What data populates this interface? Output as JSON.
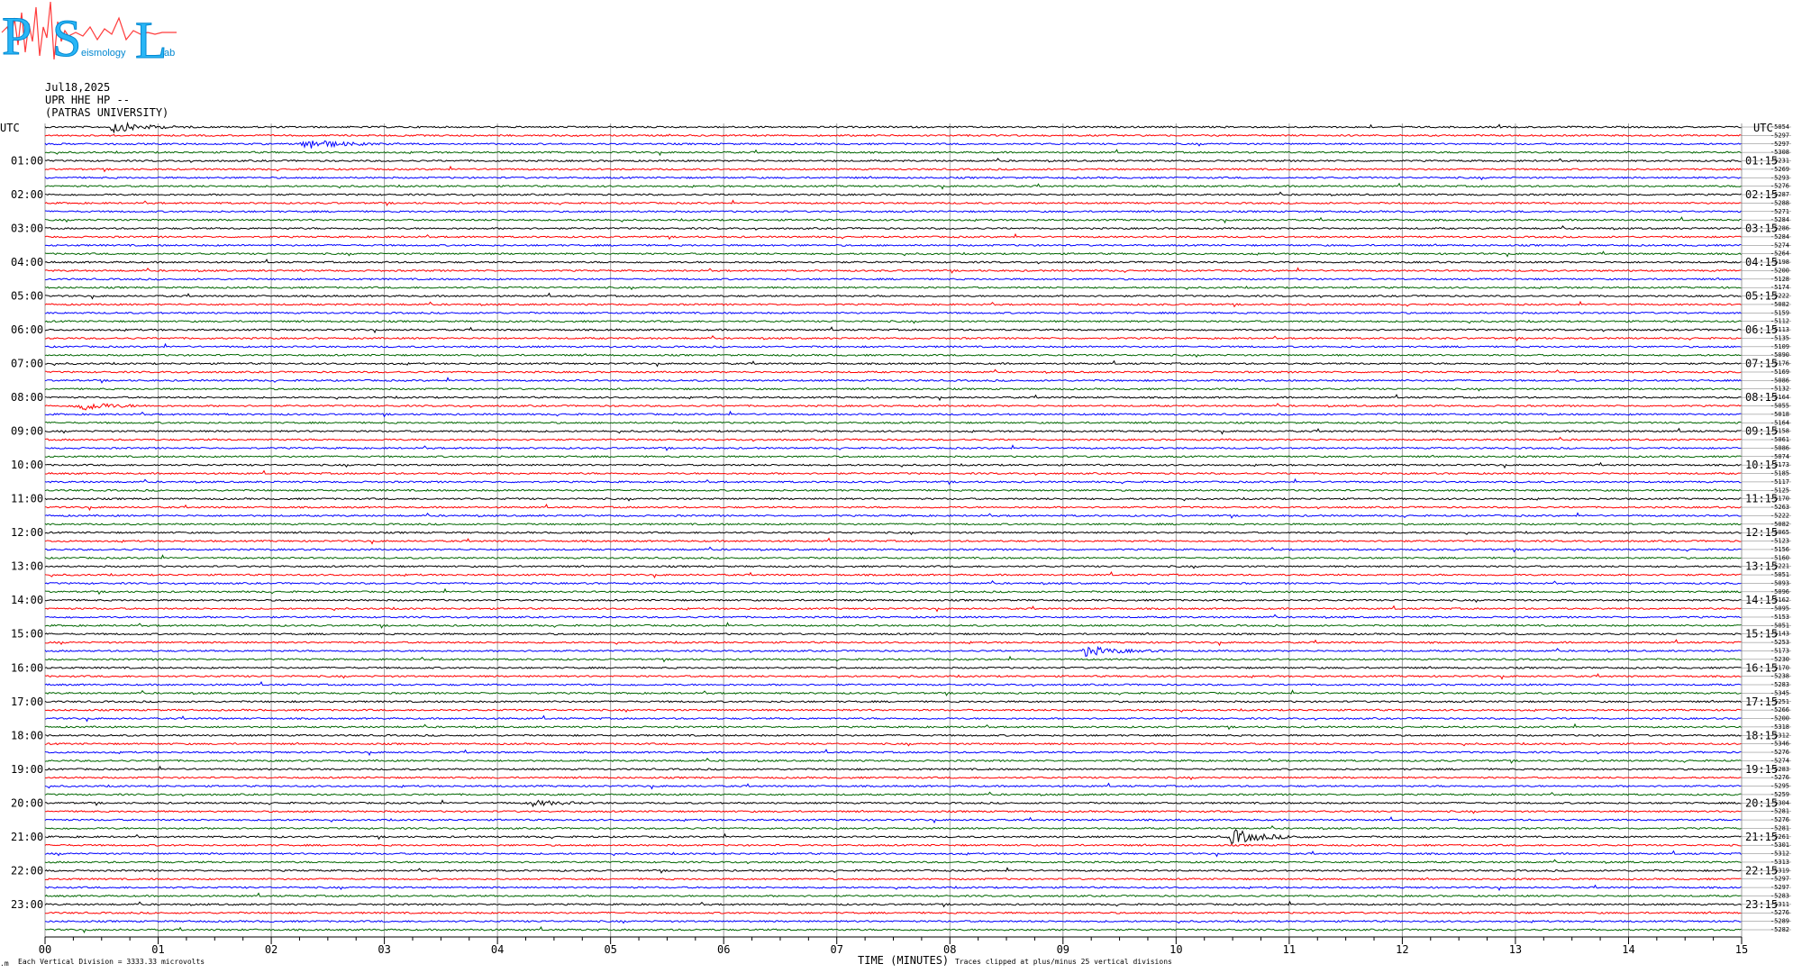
{
  "logo": {
    "letters": [
      "P",
      "S",
      "L"
    ],
    "subtitle_fragments": [
      "eismology",
      "ab"
    ]
  },
  "header": {
    "date": "Jul18,2025",
    "station": "UPR HHE HP --",
    "institution": "(PATRAS UNIVERSITY)"
  },
  "chart_data": {
    "type": "line",
    "left_axis_title": "UTC",
    "right_axis_title": "UTC",
    "left_hour_labels": [
      "01:00",
      "02:00",
      "03:00",
      "04:00",
      "05:00",
      "06:00",
      "07:00",
      "08:00",
      "09:00",
      "10:00",
      "11:00",
      "12:00",
      "13:00",
      "14:00",
      "15:00",
      "16:00",
      "17:00",
      "18:00",
      "19:00",
      "20:00",
      "21:00",
      "22:00",
      "23:00"
    ],
    "right_hour_labels": [
      "01:15",
      "02:15",
      "03:15",
      "04:15",
      "05:15",
      "06:15",
      "07:15",
      "08:15",
      "09:15",
      "10:15",
      "11:15",
      "12:15",
      "13:15",
      "14:15",
      "15:15",
      "16:15",
      "17:15",
      "18:15",
      "19:15",
      "20:15",
      "21:15",
      "22:15",
      "23:15"
    ],
    "x_tick_labels": [
      "00",
      "01",
      "02",
      "03",
      "04",
      "05",
      "06",
      "07",
      "08",
      "09",
      "10",
      "11",
      "12",
      "13",
      "14",
      "15"
    ],
    "xlabel": "TIME (MINUTES)",
    "xlim": [
      0,
      15
    ],
    "trace_colors": [
      "#000000",
      "#ff0000",
      "#0000ff",
      "#006600"
    ],
    "trace_offsets": [
      "-5054",
      "-5297",
      "-5297",
      "-5308",
      "-5231",
      "-5269",
      "-5293",
      "-5276",
      "-5287",
      "-5288",
      "-5271",
      "-5284",
      "-5286",
      "-5284",
      "-5274",
      "-5264",
      "-5198",
      "-5200",
      "-5128",
      "-5174",
      "-5222",
      "-5082",
      "-5159",
      "-5112",
      "-5113",
      "-5135",
      "-5109",
      "-5090",
      "-5176",
      "-5169",
      "-5086",
      "-5132",
      "-5164",
      "-5055",
      "-5018",
      "-5164",
      "-5158",
      "-5061",
      "-5086",
      "-5074",
      "-5173",
      "-5185",
      "-5117",
      "-5125",
      "-5170",
      "-5263",
      "-5222",
      "-5082",
      "-5065",
      "-5123",
      "-5156",
      "-5160",
      "-5221",
      "-5051",
      "-5093",
      "-5096",
      "-5162",
      "-5095",
      "-5153",
      "-5051",
      "-5143",
      "-5253",
      "-5173",
      "-5230",
      "-5170",
      "-5238",
      "-5283",
      "-5345",
      "-5251",
      "-5266",
      "-5200",
      "-5318",
      "-5312",
      "-5346",
      "-5276",
      "-5274",
      "-5283",
      "-5276",
      "-5295",
      "-5259",
      "-5304",
      "-5281",
      "-5276",
      "-5281",
      "-5261",
      "-5301",
      "-5312",
      "-5313",
      "-5319",
      "-5297",
      "-5297",
      "-5283",
      "-5311",
      "-5276",
      "-5289",
      "-5282"
    ],
    "events": [
      {
        "trace": 0,
        "minute": 0.6,
        "amplitude": 1.0
      },
      {
        "trace": 2,
        "minute": 2.3,
        "amplitude": 1.1
      },
      {
        "trace": 33,
        "minute": 0.3,
        "amplitude": 0.9
      },
      {
        "trace": 62,
        "minute": 9.2,
        "amplitude": 0.9
      },
      {
        "trace": 80,
        "minute": 4.3,
        "amplitude": 0.5
      },
      {
        "trace": 84,
        "minute": 10.5,
        "amplitude": 1.4
      }
    ],
    "scale_note": "Each Vertical Division = 3333.33 microvolts",
    "clip_note": "Traces clipped at plus/minus 25 vertical divisions",
    "corner_mark": ".m"
  }
}
